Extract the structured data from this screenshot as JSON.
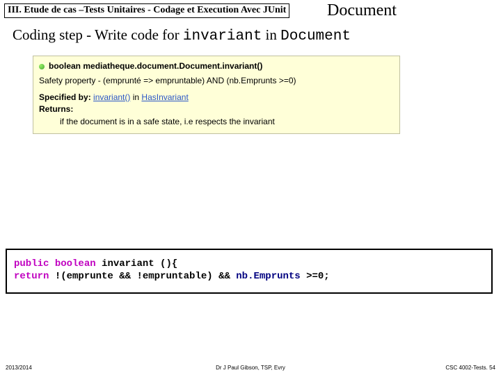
{
  "header_box": "III. Etude de cas –Tests Unitaires - Codage et Execution Avec JUnit",
  "title_right": "Document",
  "subtitle": {
    "pre": "Coding step - Write code for ",
    "code1": "invariant",
    "mid": " in ",
    "code2": "Document"
  },
  "javadoc": {
    "sig_prefix": "boolean ",
    "sig_method": "mediatheque.document.Document.invariant()",
    "safety": "Safety property - (emprunté => empruntable) AND (nb.Emprunts >=0)",
    "specified_label": "Specified by:",
    "specified_link": "invariant()",
    "specified_in": " in ",
    "specified_type": "HasInvariant",
    "returns_label": "Returns:",
    "returns_text": "if the document is in a safe state, i.e respects the invariant"
  },
  "code": {
    "l1a": "public",
    "l1b": " boolean",
    "l1c": " invariant (){",
    "l2a": "return",
    "l2b": " !(emprunte && !empruntable)",
    "l2c": "   && ",
    "l2d": "nb.Emprunts",
    "l2e": " >=0;"
  },
  "footer": {
    "left": "2013/2014",
    "mid": "Dr J Paul Gibson, TSP, Evry",
    "right": "CSC 4002-Tests. 54"
  }
}
